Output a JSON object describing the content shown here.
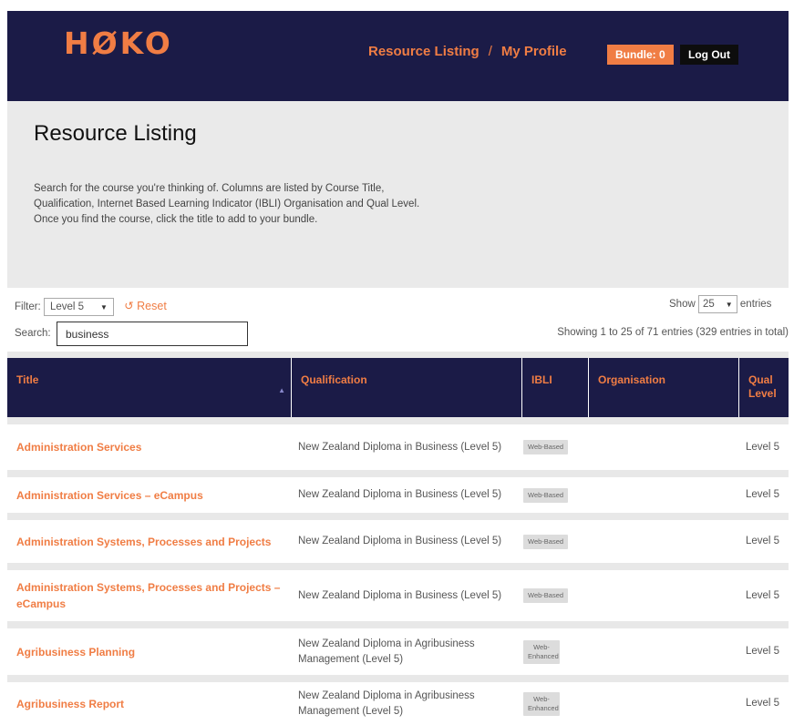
{
  "header": {
    "logo": "HØKO",
    "nav": {
      "resource_listing": "Resource Listing",
      "separator": "/",
      "my_profile": "My Profile"
    },
    "bundle_label": "Bundle: 0",
    "logout_label": "Log Out"
  },
  "intro": {
    "title": "Resource Listing",
    "description": "Search for the course you're thinking of. Columns are listed by Course Title, Qualification, Internet Based Learning Indicator (IBLI) Organisation and Qual Level. Once you find the course, click the title to add to your bundle."
  },
  "controls": {
    "filter_label": "Filter:",
    "filter_value": "Level 5",
    "reset_label": "Reset",
    "show_label": "Show",
    "show_value": "25",
    "entries_label": "entries",
    "search_label": "Search:",
    "search_value": "business",
    "info": "Showing 1 to 25 of 71 entries (329 entries in total)"
  },
  "table": {
    "columns": [
      "Title",
      "Qualification",
      "IBLI",
      "Organisation",
      "Qual Level"
    ],
    "rows": [
      {
        "title": "Administration Services",
        "qualification": "New Zealand Diploma in Business (Level 5)",
        "ibli": "Web-Based",
        "organisation": "",
        "level": "Level 5"
      },
      {
        "title": "Administration Services – eCampus",
        "qualification": "New Zealand Diploma in Business (Level 5)",
        "ibli": "Web-Based",
        "organisation": "",
        "level": "Level 5"
      },
      {
        "title": "Administration Systems, Processes and Projects",
        "qualification": "New Zealand Diploma in Business (Level 5)",
        "ibli": "Web-Based",
        "organisation": "",
        "level": "Level 5"
      },
      {
        "title": "Administration Systems, Processes and Projects – eCampus",
        "qualification": "New Zealand Diploma in Business (Level 5)",
        "ibli": "Web-Based",
        "organisation": "",
        "level": "Level 5"
      },
      {
        "title": "Agribusiness Planning",
        "qualification": "New Zealand Diploma in Agribusiness Management (Level 5)",
        "ibli": "Web-Enhanced",
        "organisation": "",
        "level": "Level 5"
      },
      {
        "title": "Agribusiness Report",
        "qualification": "New Zealand Diploma in Agribusiness Management (Level 5)",
        "ibli": "Web-Enhanced",
        "organisation": "",
        "level": "Level 5"
      }
    ]
  },
  "colors": {
    "navy": "#1b1b47",
    "orange": "#f07d44",
    "grey_band": "#eaeaea"
  },
  "icons": {
    "sort": "sort-asc-icon",
    "reset": "reset-icon",
    "dropdown": "chevron-down-icon"
  }
}
